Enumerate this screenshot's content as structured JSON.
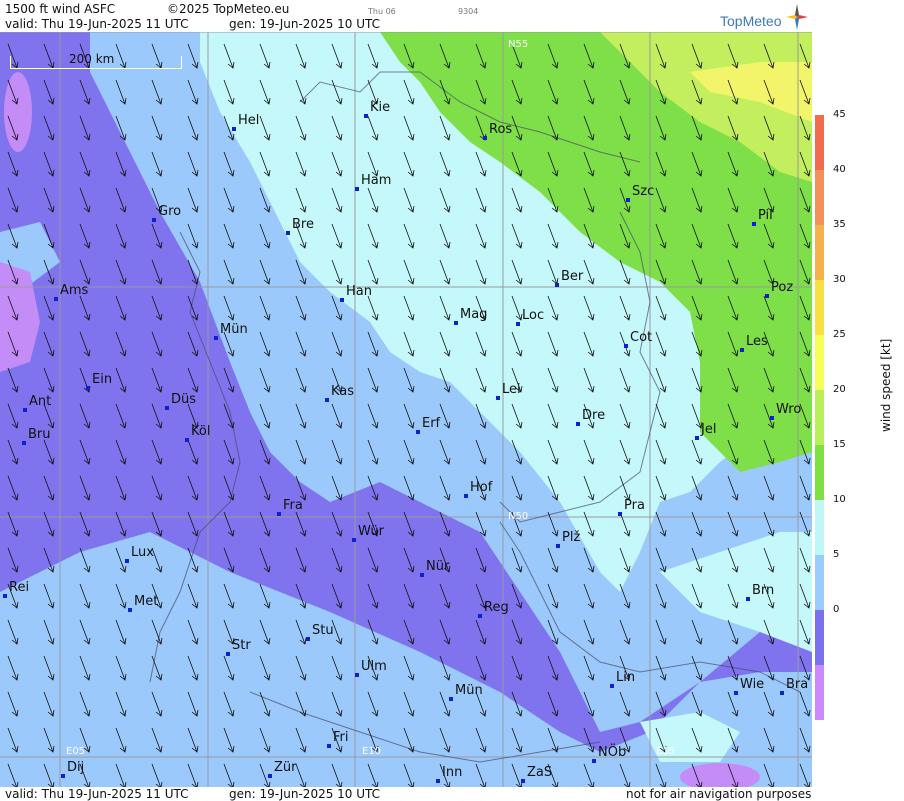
{
  "header": {
    "product": "1500 ft wind ASFC",
    "copyright": "©2025 TopMeteo.eu",
    "day_tab": "Thu 06",
    "code": "9304",
    "valid": "valid:  Thu  19-Jun-2025  11 UTC",
    "gen": "gen: 19-Jun-2025 10 UTC",
    "logo": "TopMeteo"
  },
  "footer": {
    "valid": "valid:  Thu  19-Jun-2025  11 UTC",
    "gen": "gen: 19-Jun-2025 10 UTC",
    "note": "not for air navigation purposes"
  },
  "scale_bar": "200 km",
  "grid_labels": [
    "N55",
    "N50",
    "E05",
    "E10",
    "E15"
  ],
  "legend": {
    "unit_label": "wind speed  [kt]",
    "ticks": [
      "45",
      "40",
      "35",
      "30",
      "25",
      "20",
      "15",
      "10",
      "5",
      "0"
    ],
    "colors": [
      "#f26b4d",
      "#f4915a",
      "#f5b24a",
      "#f7e040",
      "#f5ff55",
      "#b9f05a",
      "#7ee042",
      "#bff7f7",
      "#99ccff",
      "#7a71ee",
      "#cc88ff"
    ]
  },
  "cities": [
    {
      "name": "Kie"
    },
    {
      "name": "Hel"
    },
    {
      "name": "Ros"
    },
    {
      "name": "Ham"
    },
    {
      "name": "Szc"
    },
    {
      "name": "Gro"
    },
    {
      "name": "Bre"
    },
    {
      "name": "Pil"
    },
    {
      "name": "Ber"
    },
    {
      "name": "Ams"
    },
    {
      "name": "Han"
    },
    {
      "name": "Poz"
    },
    {
      "name": "Mag"
    },
    {
      "name": "Loc"
    },
    {
      "name": "Mün"
    },
    {
      "name": "Cot"
    },
    {
      "name": "Les"
    },
    {
      "name": "Ein"
    },
    {
      "name": "Lei"
    },
    {
      "name": "Kas"
    },
    {
      "name": "Ant"
    },
    {
      "name": "Düs"
    },
    {
      "name": "Dre"
    },
    {
      "name": "Wro"
    },
    {
      "name": "Erf"
    },
    {
      "name": "Bru"
    },
    {
      "name": "Köl"
    },
    {
      "name": "Jel"
    },
    {
      "name": "Hof"
    },
    {
      "name": "Fra"
    },
    {
      "name": "Pra"
    },
    {
      "name": "Wür"
    },
    {
      "name": "Plž"
    },
    {
      "name": "Lux"
    },
    {
      "name": "Nür"
    },
    {
      "name": "Rei"
    },
    {
      "name": "Met"
    },
    {
      "name": "Brn"
    },
    {
      "name": "Reg"
    },
    {
      "name": "Stu"
    },
    {
      "name": "Str"
    },
    {
      "name": "Ulm"
    },
    {
      "name": "Lin"
    },
    {
      "name": "Wie"
    },
    {
      "name": "Bra"
    },
    {
      "name": "Mün"
    },
    {
      "name": "Fri"
    },
    {
      "name": "NÖb"
    },
    {
      "name": "Dij"
    },
    {
      "name": "Zür"
    },
    {
      "name": "Inn"
    },
    {
      "name": "ZaS"
    }
  ]
}
